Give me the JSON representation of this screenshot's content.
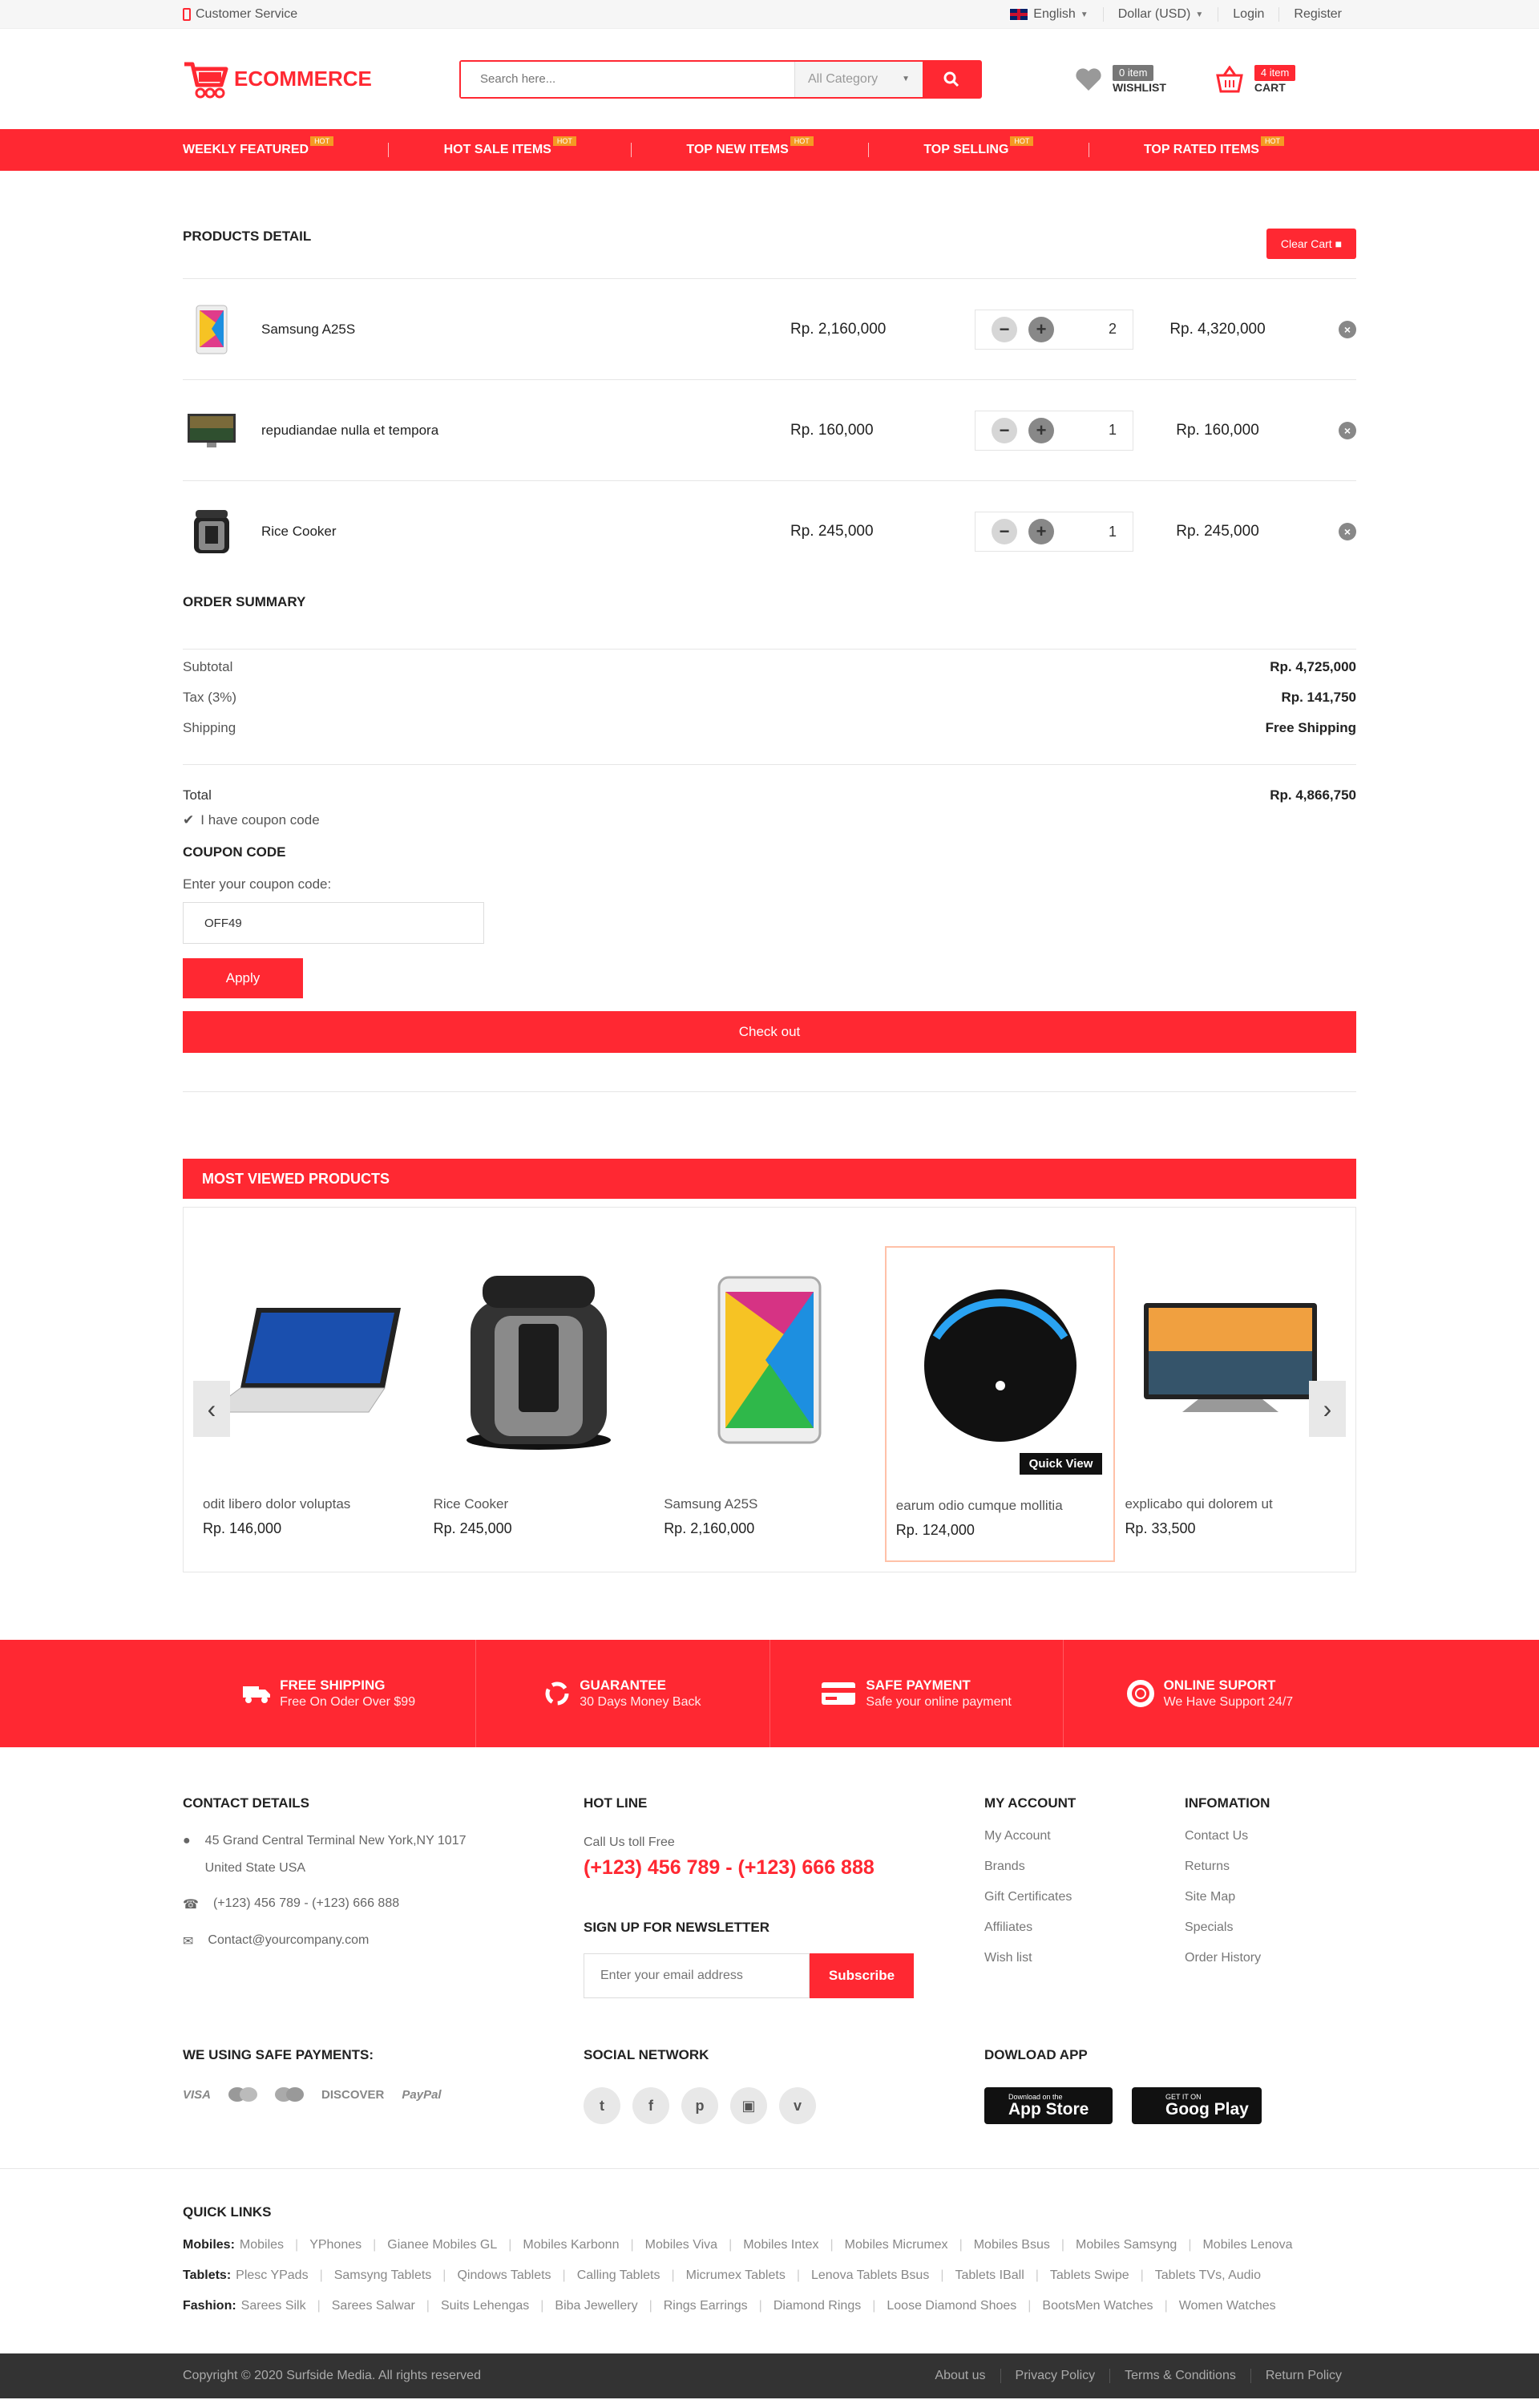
{
  "topbar": {
    "customer_service": "Customer Service",
    "language": "English",
    "currency": "Dollar (USD)",
    "login": "Login",
    "register": "Register"
  },
  "header": {
    "logo": "ECOMMERCE",
    "search_placeholder": "Search here...",
    "category": "All Category",
    "wishlist_count": "0 item",
    "wishlist_label": "WISHLIST",
    "cart_count": "4 item",
    "cart_label": "CART"
  },
  "nav": {
    "hot": "HOT",
    "items": [
      "WEEKLY FEATURED",
      "HOT SALE ITEMS",
      "TOP NEW ITEMS",
      "TOP SELLING",
      "TOP RATED ITEMS"
    ]
  },
  "cart": {
    "title": "PRODUCTS DETAIL",
    "clear_label": "Clear Cart",
    "items": [
      {
        "name": "Samsung A25S",
        "price": "Rp. 2,160,000",
        "qty": "2",
        "total": "Rp. 4,320,000"
      },
      {
        "name": "repudiandae nulla et tempora",
        "price": "Rp. 160,000",
        "qty": "1",
        "total": "Rp. 160,000"
      },
      {
        "name": "Rice Cooker",
        "price": "Rp. 245,000",
        "qty": "1",
        "total": "Rp. 245,000"
      }
    ]
  },
  "summary": {
    "title": "ORDER SUMMARY",
    "subtotal_label": "Subtotal",
    "subtotal": "Rp. 4,725,000",
    "tax_label": "Tax (3%)",
    "tax": "Rp. 141,750",
    "shipping_label": "Shipping",
    "shipping": "Free Shipping",
    "total_label": "Total",
    "total": "Rp. 4,866,750",
    "coupon_check": "I have coupon code",
    "coupon_title": "COUPON CODE",
    "coupon_label": "Enter your coupon code:",
    "coupon_value": "OFF49",
    "apply": "Apply",
    "checkout": "Check out"
  },
  "most_viewed": {
    "title": "MOST VIEWED PRODUCTS",
    "quick_view": "Quick View",
    "items": [
      {
        "name": "odit libero dolor voluptas",
        "price": "Rp. 146,000"
      },
      {
        "name": "Rice Cooker",
        "price": "Rp. 245,000"
      },
      {
        "name": "Samsung A25S",
        "price": "Rp. 2,160,000"
      },
      {
        "name": "earum odio cumque mollitia",
        "price": "Rp. 124,000"
      },
      {
        "name": "explicabo qui dolorem ut",
        "price": "Rp. 33,500"
      }
    ]
  },
  "features": [
    {
      "title": "FREE SHIPPING",
      "sub": "Free On Oder Over $99"
    },
    {
      "title": "GUARANTEE",
      "sub": "30 Days Money Back"
    },
    {
      "title": "SAFE PAYMENT",
      "sub": "Safe your online payment"
    },
    {
      "title": "ONLINE SUPORT",
      "sub": "We Have Support 24/7"
    }
  ],
  "footer": {
    "contact_title": "CONTACT DETAILS",
    "address1": "45 Grand Central Terminal New York,NY 1017",
    "address2": "United State USA",
    "phone": "(+123) 456 789 - (+123) 666 888",
    "email": "Contact@yourcompany.com",
    "hotline_title": "HOT LINE",
    "call_free": "Call Us toll Free",
    "hotline": "(+123) 456 789 - (+123) 666 888",
    "newsletter_title": "SIGN UP FOR NEWSLETTER",
    "newsletter_placeholder": "Enter your email address",
    "subscribe": "Subscribe",
    "account_title": "MY ACCOUNT",
    "account_links": [
      "My Account",
      "Brands",
      "Gift Certificates",
      "Affiliates",
      "Wish list"
    ],
    "info_title": "INFOMATION",
    "info_links": [
      "Contact Us",
      "Returns",
      "Site Map",
      "Specials",
      "Order History"
    ],
    "payments_title": "WE USING SAFE PAYMENTS:",
    "payments": [
      "VISA",
      "MasterCard",
      "Cirrus",
      "DISCOVER",
      "PayPal"
    ],
    "social_title": "SOCIAL NETWORK",
    "app_title": "DOWLOAD APP",
    "appstore_small": "Download on the",
    "appstore": "App Store",
    "googleplay_small": "GET IT ON",
    "googleplay": "Goog Play",
    "quick_links_title": "QUICK LINKS",
    "quick_links": [
      {
        "label": "Mobiles:",
        "links": [
          "Mobiles",
          "YPhones",
          "Gianee Mobiles GL",
          "Mobiles Karbonn",
          "Mobiles Viva",
          "Mobiles Intex",
          "Mobiles Micrumex",
          "Mobiles Bsus",
          "Mobiles Samsyng",
          "Mobiles Lenova"
        ]
      },
      {
        "label": "Tablets:",
        "links": [
          "Plesc YPads",
          "Samsyng Tablets",
          "Qindows Tablets",
          "Calling Tablets",
          "Micrumex Tablets",
          "Lenova Tablets Bsus",
          "Tablets IBall",
          "Tablets Swipe",
          "Tablets TVs, Audio"
        ]
      },
      {
        "label": "Fashion:",
        "links": [
          "Sarees Silk",
          "Sarees Salwar",
          "Suits Lehengas",
          "Biba Jewellery",
          "Rings Earrings",
          "Diamond Rings",
          "Loose Diamond Shoes",
          "BootsMen Watches",
          "Women Watches"
        ]
      }
    ],
    "copyright": "Copyright © 2020 Surfside Media. All rights reserved",
    "bottom_links": [
      "About us",
      "Privacy Policy",
      "Terms & Conditions",
      "Return Policy"
    ]
  }
}
